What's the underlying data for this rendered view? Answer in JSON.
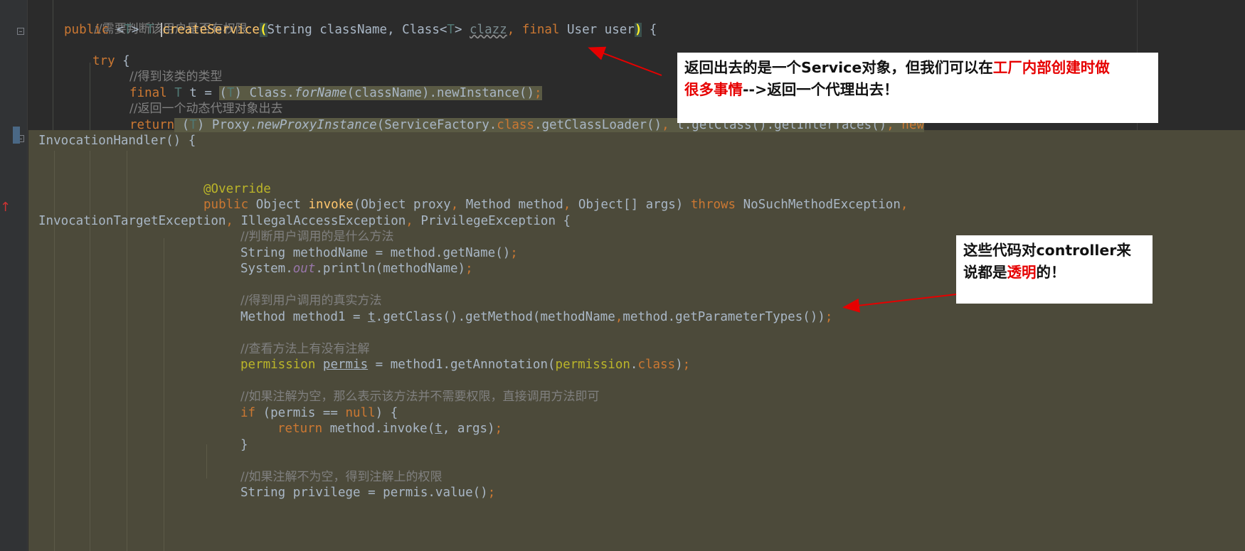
{
  "code": {
    "c_permission": "//需要判断该用户是否有权限",
    "public": "public",
    "lt": " <",
    "T": "T",
    "gt": "> ",
    "T2": "T ",
    "createService": "createService",
    "paren_open": "(",
    "string_classname": "String className, ",
    "class_lt": "Class<",
    "T3": "T",
    "gt2": "> ",
    "clazz": "clazz",
    "comma": ", ",
    "final": "final",
    "user_param": " User user",
    "paren_close": ")",
    "brace": " {",
    "try": "try",
    "try_brace": " {",
    "c_get_type": "//得到该类的类型",
    "final2": "final",
    "T4": " T",
    "t_assign": " t = ",
    "cast_open": "(",
    "T5": "T",
    "cast_close": ") ",
    "class_dot": "Class.",
    "forName": "forName",
    "newinstance": "(className).newInstance()",
    "semi": ";",
    "c_return_proxy": "//返回一个动态代理对象出去",
    "return": "return",
    "cast2_open": " (",
    "T6": "T",
    "cast2_close": ") ",
    "proxy_dot": "Proxy.",
    "newProxyInstance": "newProxyInstance",
    "sf": "(ServiceFactory.",
    "class_kw": "class",
    "getclassloader": ".getClassLoader()",
    "comma2": ", ",
    "getinterfaces": "t.getClass().getInterfaces()",
    "comma3": ", ",
    "new_kw": "new",
    "invocation_handler": "InvocationHandler() {",
    "override": "@Override",
    "public2": "public",
    "object_ret": " Object ",
    "invoke": "invoke",
    "invoke_params_a": "(Object proxy",
    "comma4": ", ",
    "invoke_params_b": "Method method",
    "comma5": ", ",
    "invoke_params_c": "Object[] args) ",
    "throws": "throws",
    "nsme": " NoSuchMethodException",
    "comma6": ",",
    "ite": "InvocationTargetException",
    "comma7": ", ",
    "iae": "IllegalAccessException",
    "comma8": ", ",
    "pe": "PrivilegeException {",
    "c_which_method": "//判断用户调用的是什么方法",
    "method_name_decl": "String methodName = method.getName()",
    "semi2": ";",
    "system_dot": "System.",
    "out": "out",
    "println": ".println(methodName)",
    "semi3": ";",
    "c_real_method": "//得到用户调用的真实方法",
    "method1_decl": "Method method1 = ",
    "t_ul": "t",
    "getmethod_a": ".getClass().getMethod(methodName",
    "comma9": ",",
    "getmethod_b": "method.getParameterTypes())",
    "semi4": ";",
    "c_annotation": "//查看方法上有没有注解",
    "permission_type": "permission",
    "permis_var": "permis",
    "get_annotation": " = method1.getAnnotation(",
    "permission_type2": "permission",
    "dot_class": ".",
    "class_kw2": "class",
    "close_semi": ")",
    "semi5": ";",
    "c_if_null": "//如果注解为空，那么表示该方法并不需要权限，直接调用方法即可",
    "if": "if",
    "if_cond": " (permis == ",
    "null": "null",
    "if_close": ") {",
    "return2": "return",
    "invoke_call_a": " method.invoke(",
    "t_ul2": "t",
    "invoke_call_b": ", args)",
    "semi6": ";",
    "close_brace": "}",
    "c_not_null": "//如果注解不为空，得到注解上的权限",
    "privilege_decl": "String privilege = permis.value()",
    "semi7": ";"
  },
  "notes": {
    "top": {
      "a": "返回出去的是一个Service对象，但我们可以在",
      "b": "工厂内部创建时做",
      "c": "很多事情",
      "d": "-->返回一个代理出去！"
    },
    "right": {
      "a": "这些代码对controller来",
      "b": "说都是",
      "c": "透明",
      "d": "的！"
    }
  },
  "colors": {
    "background": "#2b2b2b",
    "highlight": "#4c4a3a",
    "keyword": "#cc7832",
    "comment": "#808080",
    "method": "#ffc66d",
    "annotation": "#bbb529",
    "arrow": "#e60000"
  }
}
